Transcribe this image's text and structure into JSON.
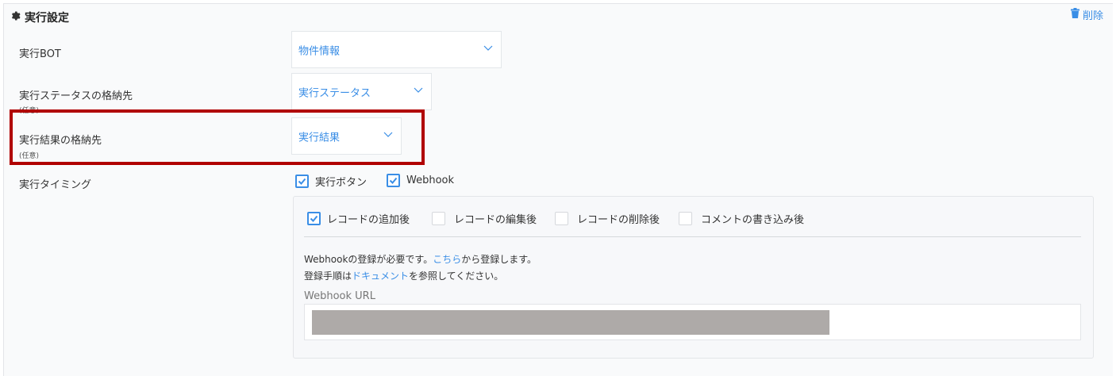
{
  "section": {
    "title": "実行設定",
    "icon": "gear-icon"
  },
  "delete": {
    "label": "削除",
    "icon": "trash-icon"
  },
  "rows": {
    "bot": {
      "label": "実行BOT",
      "value": "物件情報"
    },
    "status": {
      "label": "実行ステータスの格納先",
      "sub": "(任意)",
      "value": "実行ステータス"
    },
    "result": {
      "label": "実行結果の格納先",
      "sub": "(任意)",
      "value": "実行結果"
    },
    "timing": {
      "label": "実行タイミング",
      "options": [
        {
          "label": "実行ボタン",
          "checked": true
        },
        {
          "label": "Webhook",
          "checked": true
        }
      ]
    }
  },
  "webhook": {
    "events": [
      {
        "label": "レコードの追加後",
        "checked": true
      },
      {
        "label": "レコードの編集後",
        "checked": false
      },
      {
        "label": "レコードの削除後",
        "checked": false
      },
      {
        "label": "コメントの書き込み後",
        "checked": false
      }
    ],
    "line1_before": "Webhookの登録が必要です。",
    "line1_link": "こちら",
    "line1_after": "から登録します。",
    "line2_before": "登録手順は",
    "line2_link": "ドキュメント",
    "line2_after": "を参照してください。",
    "url_label": "Webhook URL",
    "url_value": ""
  },
  "colors": {
    "accent": "#3a8ee6",
    "highlight": "#b00000"
  }
}
